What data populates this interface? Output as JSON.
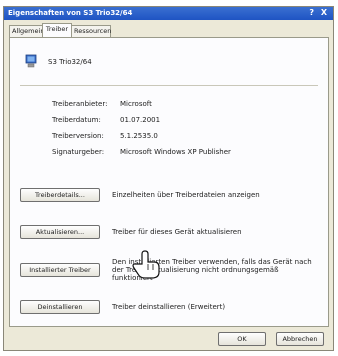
{
  "window": {
    "title": "Eigenschaften von S3 Trio32/64",
    "help_btn": "?",
    "close_btn": "X"
  },
  "tabs": [
    {
      "label": "Allgemein"
    },
    {
      "label": "Treiber"
    },
    {
      "label": "Ressourcen"
    }
  ],
  "device": {
    "name": "S3 Trio32/64",
    "icon": "display-adapter-icon"
  },
  "driver_info": [
    {
      "label": "Treiberanbieter:",
      "value": "Microsoft"
    },
    {
      "label": "Treiberdatum:",
      "value": "01.07.2001"
    },
    {
      "label": "Treiberversion:",
      "value": "5.1.2535.0"
    },
    {
      "label": "Signaturgeber:",
      "value": "Microsoft Windows XP Publisher"
    }
  ],
  "actions": [
    {
      "button": "Treiberdetails...",
      "description": "Einzelheiten über Treiberdateien anzeigen"
    },
    {
      "button": "Aktualisieren...",
      "description": "Treiber für dieses Gerät aktualisieren"
    },
    {
      "button": "Installierter Treiber",
      "description": "Den installierten Treiber verwenden, falls das Gerät nach der Treiberaktualisierung nicht ordnungsgemäß funktioniert"
    },
    {
      "button": "Deinstallieren",
      "description": "Treiber deinstallieren (Erweitert)"
    }
  ],
  "footer": {
    "ok": "OK",
    "cancel": "Abbrechen"
  }
}
